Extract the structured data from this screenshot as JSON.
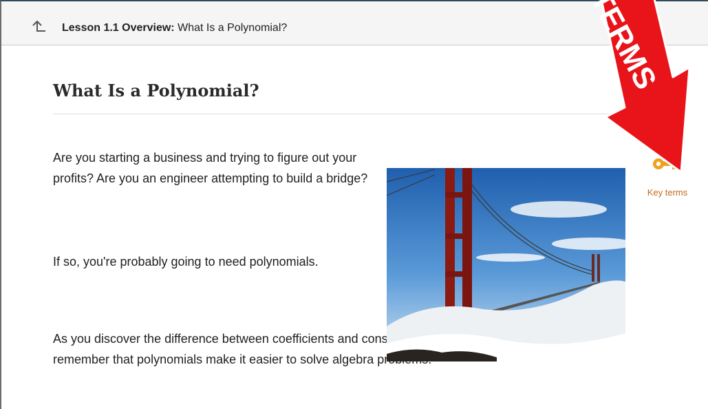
{
  "header": {
    "lesson_label": "Lesson 1.1 Overview:",
    "lesson_title": "What Is a Polynomial?"
  },
  "main": {
    "title": "What Is a Polynomial?",
    "paragraphs": [
      "Are you starting a business and trying to figure out your profits? Are you an engineer attempting to build a bridge?",
      "If so, you're probably going to need polynomials.",
      "As you discover the difference between coefficients and constants, remember that polynomials make it easier to solve algebra problems."
    ]
  },
  "sidebar": {
    "key_terms_label": "Key terms",
    "key_color": "#f0a020"
  },
  "annotation": {
    "text": "TERMS",
    "color": "#e8141a"
  },
  "icons": {
    "up": "arrow-up-left-icon",
    "key": "key-icon"
  }
}
